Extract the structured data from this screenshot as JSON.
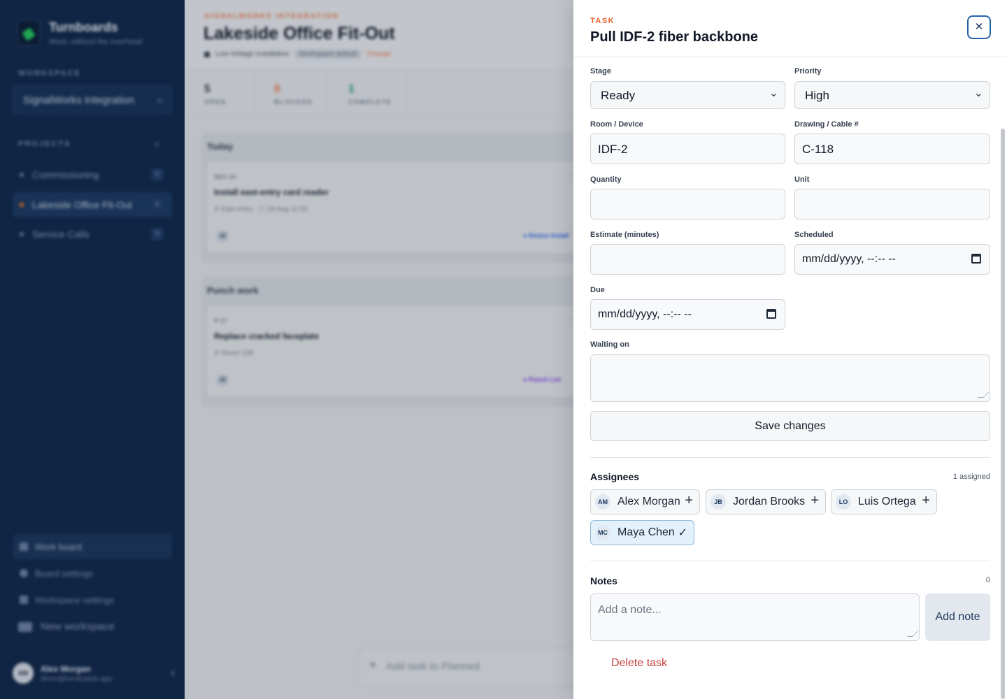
{
  "sidebar": {
    "brand": {
      "name": "Turnboards",
      "tagline": "Work, without the overhead"
    },
    "workspace_label": "WORKSPACE",
    "workspace_value": "SignalWorks Integration",
    "projects_label": "PROJECTS",
    "projects_add": "+",
    "projects": [
      {
        "name": "Commissioning",
        "count": "0",
        "active": false
      },
      {
        "name": "Lakeside Office Fit-Out",
        "count": "6",
        "active": true
      },
      {
        "name": "Service Calls",
        "count": "0",
        "active": false
      }
    ],
    "nav": [
      {
        "label": "Work board",
        "active": true
      },
      {
        "label": "Board settings",
        "active": false
      },
      {
        "label": "Workspace settings",
        "active": false
      }
    ],
    "new_workspace": "New workspace",
    "user": {
      "initials": "AM",
      "name": "Alex Morgan",
      "email": "demo@turnboards.app"
    }
  },
  "board": {
    "eyebrow": "SIGNALWORKS INTEGRATION",
    "title": "Lakeside Office Fit-Out",
    "template": "Low-Voltage Installation",
    "template_badge": "Workspace default",
    "change_link": "Change",
    "stats": [
      {
        "value": "5",
        "label": "OPEN",
        "color": "#374151"
      },
      {
        "value": "0",
        "label": "BLOCKED",
        "color": "#e87b4a"
      },
      {
        "value": "1",
        "label": "COMPLETE",
        "color": "#1f9d6b"
      }
    ],
    "columns": [
      {
        "title": "Today",
        "card": {
          "id": "SEC-14",
          "title": "Install east-entry card reader",
          "location": "East entry",
          "date": "18 Aug 11:00",
          "assignee": "JB",
          "tag": "● Device Install",
          "tag_color": "#2563eb"
        }
      },
      {
        "title": "Punch work",
        "card": {
          "id": "P-17",
          "title": "Replace cracked faceplate",
          "location": "Room 108",
          "date": "",
          "assignee": "JB",
          "tag": "● Punch List",
          "tag_color": "#7c3aed"
        }
      }
    ],
    "add_task": "Add task to Planned"
  },
  "drawer": {
    "eyebrow": "TASK",
    "title": "Pull IDF-2 fiber backbone",
    "close_icon": "✕",
    "fields": {
      "stage": {
        "label": "Stage",
        "value": "Ready"
      },
      "priority": {
        "label": "Priority",
        "value": "High"
      },
      "room": {
        "label": "Room / Device",
        "value": "IDF-2"
      },
      "drawing": {
        "label": "Drawing / Cable #",
        "value": "C-118"
      },
      "quantity": {
        "label": "Quantity",
        "value": ""
      },
      "unit": {
        "label": "Unit",
        "value": ""
      },
      "estimate": {
        "label": "Estimate (minutes)",
        "value": ""
      },
      "scheduled": {
        "label": "Scheduled",
        "value": "mm/dd/yyyy, --:-- --"
      },
      "due": {
        "label": "Due",
        "value": "mm/dd/yyyy, --:-- --"
      },
      "waiting": {
        "label": "Waiting on",
        "value": ""
      }
    },
    "save_label": "Save changes",
    "assignees": {
      "title": "Assignees",
      "meta": "1 assigned",
      "people": [
        {
          "initials": "AM",
          "name": "Alex Morgan",
          "assigned": false
        },
        {
          "initials": "JB",
          "name": "Jordan Brooks",
          "assigned": false
        },
        {
          "initials": "LO",
          "name": "Luis Ortega",
          "assigned": false
        },
        {
          "initials": "MC",
          "name": "Maya Chen",
          "assigned": true
        }
      ]
    },
    "notes": {
      "title": "Notes",
      "count": "0",
      "placeholder": "Add a note...",
      "add_label": "Add note"
    },
    "delete_label": "Delete task"
  }
}
